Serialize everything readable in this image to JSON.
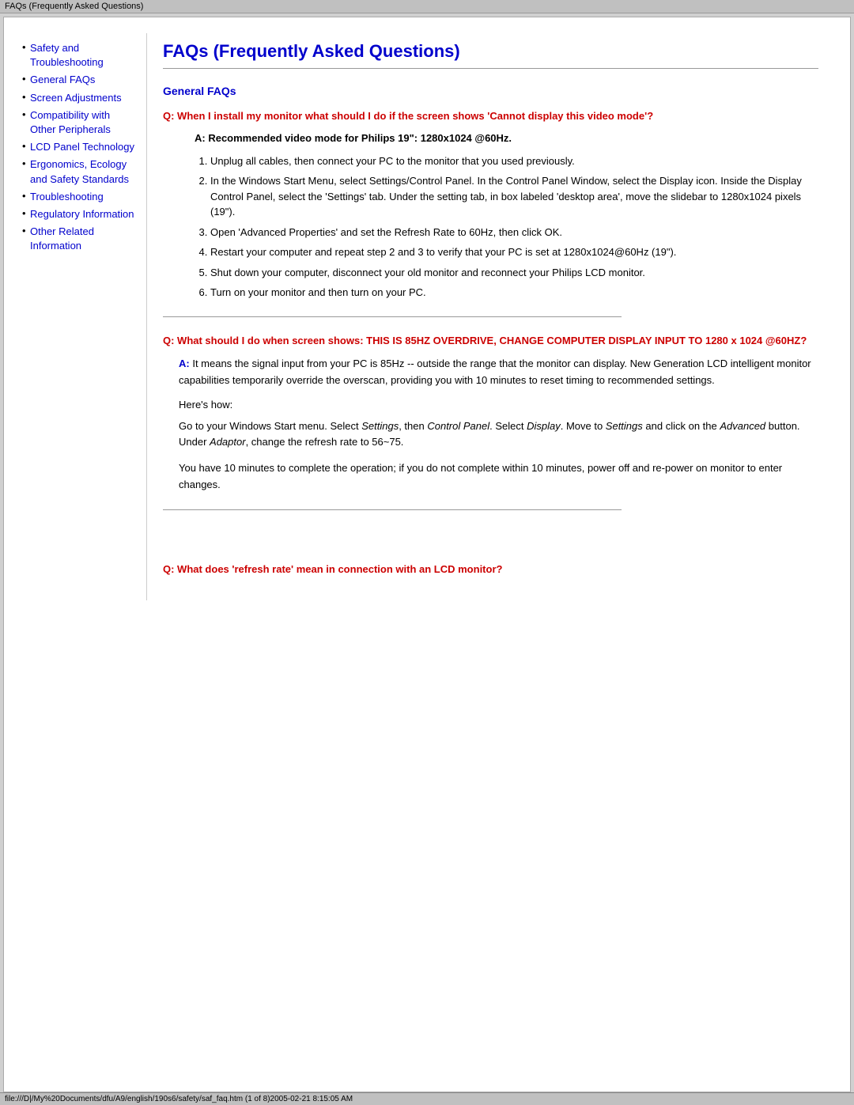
{
  "title_bar": {
    "text": "FAQs (Frequently Asked Questions)"
  },
  "status_bar": {
    "text": "file:///D|/My%20Documents/dfu/A9/english/190s6/safety/saf_faq.htm (1 of 8)2005-02-21 8:15:05 AM"
  },
  "sidebar": {
    "items": [
      {
        "label": "Safety and Troubleshooting",
        "href": "#"
      },
      {
        "label": "General FAQs",
        "href": "#"
      },
      {
        "label": "Screen Adjustments",
        "href": "#"
      },
      {
        "label": "Compatibility with Other Peripherals",
        "href": "#"
      },
      {
        "label": "LCD Panel Technology",
        "href": "#"
      },
      {
        "label": "Ergonomics, Ecology and Safety Standards",
        "href": "#"
      },
      {
        "label": "Troubleshooting",
        "href": "#"
      },
      {
        "label": "Regulatory Information",
        "href": "#"
      },
      {
        "label": "Other Related Information",
        "href": "#"
      }
    ]
  },
  "main": {
    "page_title": "FAQs (Frequently Asked Questions)",
    "section_heading": "General FAQs",
    "q1": {
      "question": "Q: When I install my monitor what should I do if the screen shows 'Cannot display this video mode'?",
      "answer_intro": "A: Recommended video mode for Philips 19\": 1280x1024 @60Hz.",
      "steps": [
        "Unplug all cables, then connect your PC to the monitor that you used previously.",
        "In the Windows Start Menu, select Settings/Control Panel. In the Control Panel Window, select the Display icon. Inside the Display Control Panel, select the 'Settings' tab. Under the setting tab, in box labeled 'desktop area', move the slidebar to 1280x1024 pixels (19\").",
        "Open 'Advanced Properties' and set the Refresh Rate to 60Hz, then click OK.",
        "Restart your computer and repeat step 2 and 3 to verify that your PC is set at 1280x1024@60Hz (19\").",
        "Shut down your computer, disconnect your old monitor and reconnect your Philips LCD monitor.",
        "Turn on your monitor and then turn on your PC."
      ]
    },
    "q2": {
      "question": "Q: What should I do when screen shows: THIS IS 85HZ OVERDRIVE, CHANGE COMPUTER DISPLAY INPUT TO 1280 x 1024 @60HZ?",
      "answer_label": "A:",
      "answer_text": "It means the signal input from your PC is 85Hz -- outside the range that the monitor can display. New Generation LCD intelligent monitor capabilities temporarily override the overscan, providing you with 10 minutes to reset timing to recommended settings.",
      "heres_how": "Here's how:",
      "go_to_text_part1": "Go to your Windows Start menu. Select ",
      "go_to_settings": "Settings",
      "go_to_text_part2": ", then ",
      "go_to_cp": "Control Panel",
      "go_to_text_part3": ". Select ",
      "go_to_display": "Display",
      "go_to_text_part4": ". Move to ",
      "go_to_settings2": "Settings",
      "go_to_text_part5": " and click on the ",
      "go_to_advanced": "Advanced",
      "go_to_text_part6": " button. Under ",
      "go_to_adaptor": "Adaptor",
      "go_to_text_part7": ", change the refresh rate to 56~75.",
      "you_have_text": "You have 10 minutes to complete the operation; if you do not complete within 10 minutes, power off and re-power on monitor to enter changes."
    },
    "q3": {
      "question": "Q: What does 'refresh rate' mean in connection with an LCD monitor?"
    }
  }
}
